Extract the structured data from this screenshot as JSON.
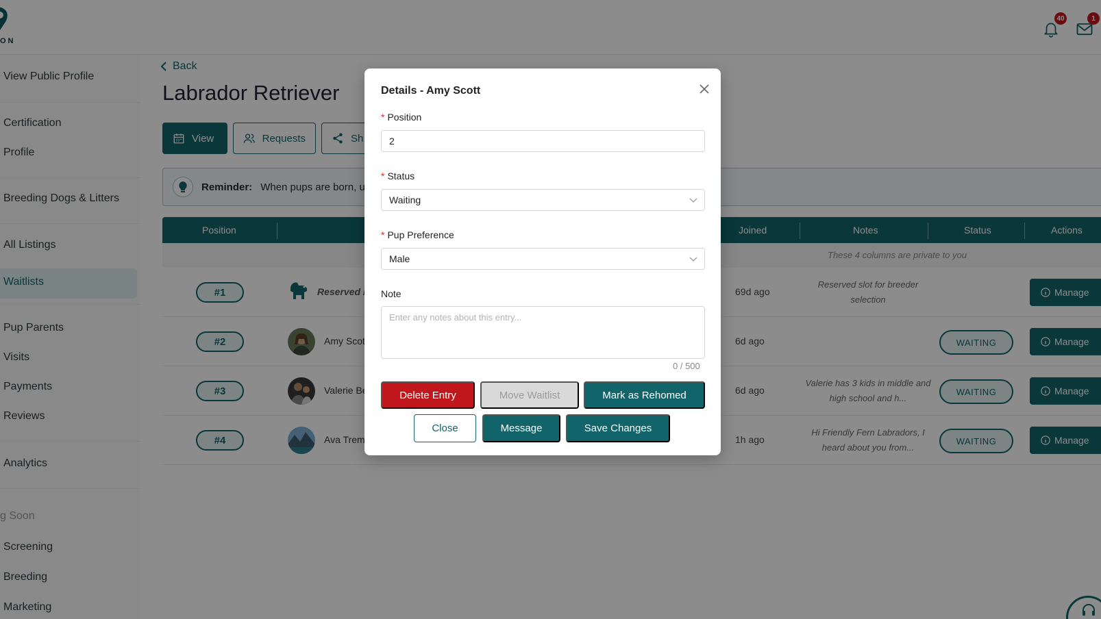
{
  "brand": {
    "logo_text": "ON"
  },
  "header": {
    "notifications": {
      "icon": "bell-icon",
      "count": "40"
    },
    "messages": {
      "icon": "mail-icon",
      "count": "1"
    }
  },
  "sidebar": {
    "items": [
      {
        "label": "View Public Profile"
      },
      {
        "label": "Certification"
      },
      {
        "label": "Profile"
      },
      {
        "label": "Breeding Dogs & Litters"
      },
      {
        "label": "All Listings"
      },
      {
        "label": "Waitlists"
      },
      {
        "label": "Pup Parents"
      },
      {
        "label": "Visits"
      },
      {
        "label": "Payments"
      },
      {
        "label": "Reviews"
      },
      {
        "label": "Analytics"
      },
      {
        "label": "g Soon"
      },
      {
        "label": "Screening"
      },
      {
        "label": "Breeding"
      },
      {
        "label": "Marketing"
      }
    ],
    "active": "Waitlists"
  },
  "page": {
    "back_label": "Back",
    "title": "Labrador Retriever",
    "tabs": [
      {
        "label": "View",
        "icon": "calendar-icon"
      },
      {
        "label": "Requests",
        "icon": "users-icon"
      },
      {
        "label": "Sh",
        "icon": "share-icon"
      }
    ],
    "reminder": {
      "label": "Reminder:",
      "text": "When pups are born, u"
    }
  },
  "table": {
    "headers": {
      "position": "Position",
      "joined": "Joined",
      "notes": "Notes",
      "status": "Status",
      "actions": "Actions"
    },
    "private_note": "These 4 columns are private to you",
    "rows": [
      {
        "position": "#1",
        "name": "Reserved b",
        "joined": "69d ago",
        "notes": "Reserved slot for breeder selection",
        "status": "",
        "action": "Manage"
      },
      {
        "position": "#2",
        "name": "Amy Scot",
        "joined": "6d ago",
        "notes": "",
        "status": "WAITING",
        "action": "Manage"
      },
      {
        "position": "#3",
        "name": "Valerie Be",
        "joined": "6d ago",
        "notes": "Valerie has 3 kids in middle and high school and h...",
        "status": "WAITING",
        "action": "Manage"
      },
      {
        "position": "#4",
        "name": "Ava Trem",
        "joined": "1h ago",
        "notes": "Hi Friendly Fern Labradors, I heard about you from...",
        "status": "WAITING",
        "action": "Manage"
      }
    ]
  },
  "modal": {
    "title": "Details - Amy Scott",
    "position_label": "Position",
    "position_value": "2",
    "status_label": "Status",
    "status_value": "Waiting",
    "preference_label": "Pup Preference",
    "preference_value": "Male",
    "note_label": "Note",
    "note_placeholder": "Enter any notes about this entry...",
    "note_counter": "0 / 500",
    "buttons": {
      "delete": "Delete Entry",
      "move": "Move Waitlist",
      "rehome": "Mark as Rehomed",
      "close": "Close",
      "message": "Message",
      "save": "Save Changes"
    }
  },
  "colors": {
    "primary": "#11646a",
    "danger": "#c0171d",
    "badge": "#c0171d"
  }
}
